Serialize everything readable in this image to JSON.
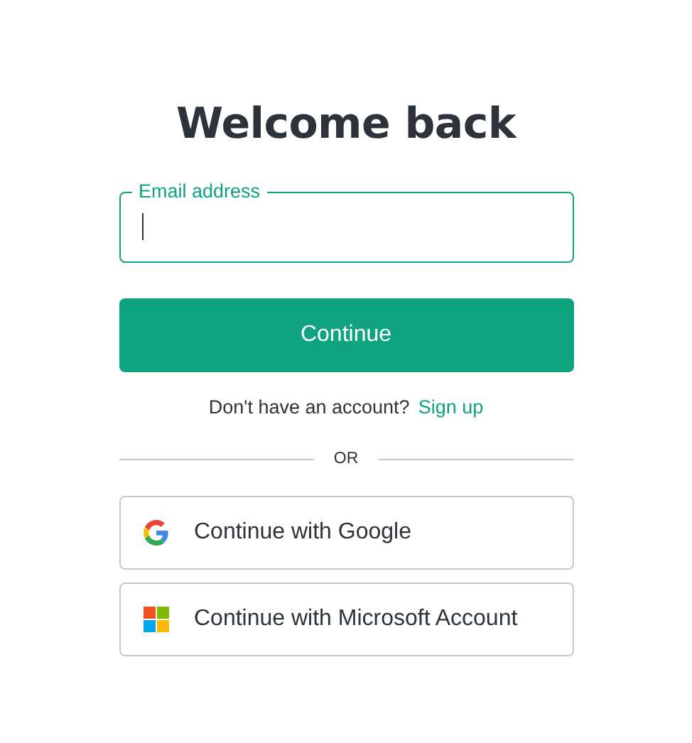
{
  "title": "Welcome back",
  "email_field": {
    "label": "Email address",
    "focused": true
  },
  "continue_button": "Continue",
  "signup": {
    "prompt": "Don't have an account?",
    "link": "Sign up"
  },
  "divider": "OR",
  "providers": [
    {
      "kind": "google",
      "label": "Continue with Google"
    },
    {
      "kind": "microsoft",
      "label": "Continue with Microsoft Account"
    }
  ]
}
